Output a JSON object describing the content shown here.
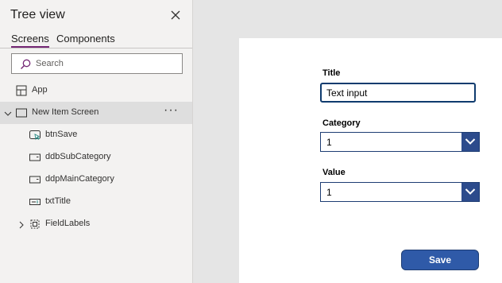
{
  "panel": {
    "title": "Tree view",
    "tabs": [
      {
        "label": "Screens",
        "active": true
      },
      {
        "label": "Components",
        "active": false
      }
    ],
    "search": {
      "placeholder": "Search",
      "value": ""
    },
    "items": [
      {
        "label": "App",
        "icon": "app-icon"
      },
      {
        "label": "New Item Screen",
        "icon": "screen-icon",
        "selected": true,
        "expanded": true,
        "more": "···"
      },
      {
        "label": "btnSave",
        "icon": "button-control-icon"
      },
      {
        "label": "ddbSubCategory",
        "icon": "dropdown-control-icon"
      },
      {
        "label": "ddpMainCategory",
        "icon": "dropdown-control-icon"
      },
      {
        "label": "txtTitle",
        "icon": "text-input-control-icon"
      },
      {
        "label": "FieldLabels",
        "icon": "group-icon",
        "expanded": false
      }
    ]
  },
  "form": {
    "title_label": "Title",
    "title_value": "Text input",
    "category_label": "Category",
    "category_value": "1",
    "value_label": "Value",
    "value_value": "1",
    "save_label": "Save"
  },
  "colors": {
    "accent": "#742774",
    "button": "#2f5aa8",
    "input_border": "#0f3b6e",
    "panel_bg": "#f3f2f1",
    "workspace_bg": "#e5e5e5"
  }
}
